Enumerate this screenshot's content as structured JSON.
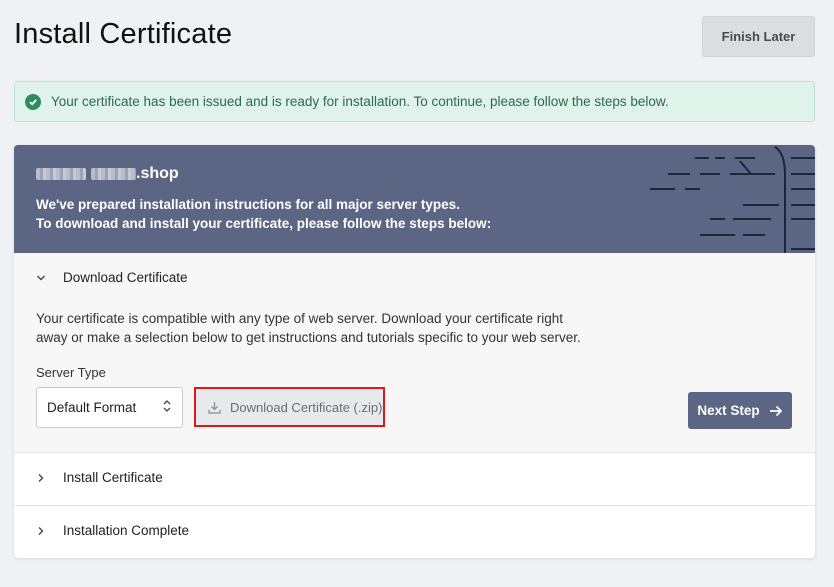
{
  "page": {
    "title": "Install Certificate",
    "finish_label": "Finish Later"
  },
  "alert": {
    "message": "Your certificate has been issued and is ready for installation. To continue, please follow the steps below."
  },
  "banner": {
    "domain_suffix": ".shop",
    "line1": "We've prepared installation instructions for all major server types.",
    "line2": "To download and install your certificate, please follow the steps below:"
  },
  "steps": [
    {
      "label": "Download Certificate",
      "expanded": true
    },
    {
      "label": "Install Certificate",
      "expanded": false
    },
    {
      "label": "Installation Complete",
      "expanded": false
    }
  ],
  "download": {
    "description": "Your certificate is compatible with any type of web server. Download your certificate right away or make a selection below to get instructions and tutorials specific to your web server.",
    "server_type_label": "Server Type",
    "server_type_value": "Default Format",
    "download_button": "Download Certificate (.zip)",
    "next_button": "Next Step"
  },
  "colors": {
    "accent": "#5b6685",
    "success": "#2f8a5f",
    "highlight": "#e3151a"
  }
}
